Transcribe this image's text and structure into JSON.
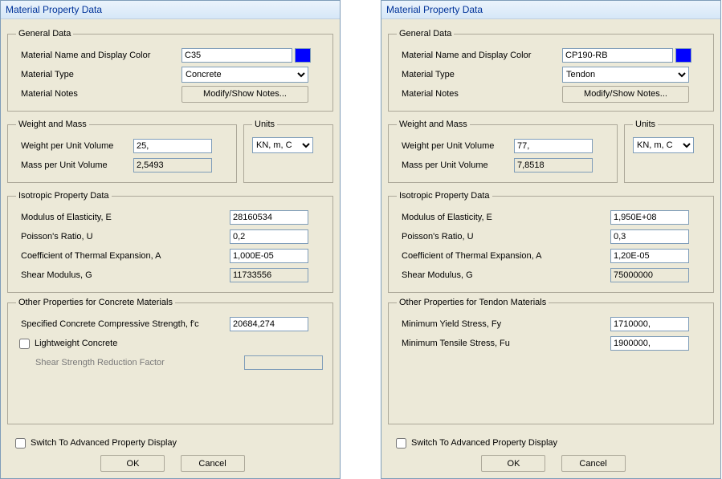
{
  "left": {
    "title": "Material Property Data",
    "general": {
      "legend": "General Data",
      "name_label": "Material Name and Display Color",
      "name_value": "C35",
      "color": "#0000ff",
      "type_label": "Material Type",
      "type_value": "Concrete",
      "notes_label": "Material Notes",
      "notes_btn": "Modify/Show Notes..."
    },
    "weight": {
      "legend": "Weight and Mass",
      "wpuv_label": "Weight per Unit Volume",
      "wpuv": "25,",
      "mpuv_label": "Mass per Unit Volume",
      "mpuv": "2,5493"
    },
    "units": {
      "legend": "Units",
      "value": "KN, m, C"
    },
    "iso": {
      "legend": "Isotropic Property Data",
      "e_label": "Modulus of Elasticity,  E",
      "e": "28160534",
      "u_label": "Poisson's Ratio,  U",
      "u": "0,2",
      "a_label": "Coefficient of Thermal Expansion,  A",
      "a": "1,000E-05",
      "g_label": "Shear Modulus,  G",
      "g": "11733556"
    },
    "other": {
      "legend": "Other Properties for Concrete Materials",
      "fc_label": "Specified Concrete Compressive Strength, f'c",
      "fc": "20684,274",
      "lw_label": "Lightweight Concrete",
      "ssrf_label": "Shear Strength Reduction Factor"
    },
    "advanced_label": "Switch To Advanced Property Display",
    "ok": "OK",
    "cancel": "Cancel"
  },
  "right": {
    "title": "Material Property Data",
    "general": {
      "legend": "General Data",
      "name_label": "Material Name and Display Color",
      "name_value": "CP190-RB",
      "color": "#0000ff",
      "type_label": "Material Type",
      "type_value": "Tendon",
      "notes_label": "Material Notes",
      "notes_btn": "Modify/Show Notes..."
    },
    "weight": {
      "legend": "Weight and Mass",
      "wpuv_label": "Weight per Unit Volume",
      "wpuv": "77,",
      "mpuv_label": "Mass per Unit Volume",
      "mpuv": "7,8518"
    },
    "units": {
      "legend": "Units",
      "value": "KN, m, C"
    },
    "iso": {
      "legend": "Isotropic Property Data",
      "e_label": "Modulus of Elasticity,  E",
      "e": "1,950E+08",
      "u_label": "Poisson's Ratio,  U",
      "u": "0,3",
      "a_label": "Coefficient of Thermal Expansion,  A",
      "a": "1,20E-05",
      "g_label": "Shear Modulus,  G",
      "g": "75000000"
    },
    "other": {
      "legend": "Other Properties for Tendon Materials",
      "fy_label": "Minimum Yield Stress, Fy",
      "fy": "1710000,",
      "fu_label": "Minimum Tensile Stress, Fu",
      "fu": "1900000,"
    },
    "advanced_label": "Switch To Advanced Property Display",
    "ok": "OK",
    "cancel": "Cancel"
  }
}
